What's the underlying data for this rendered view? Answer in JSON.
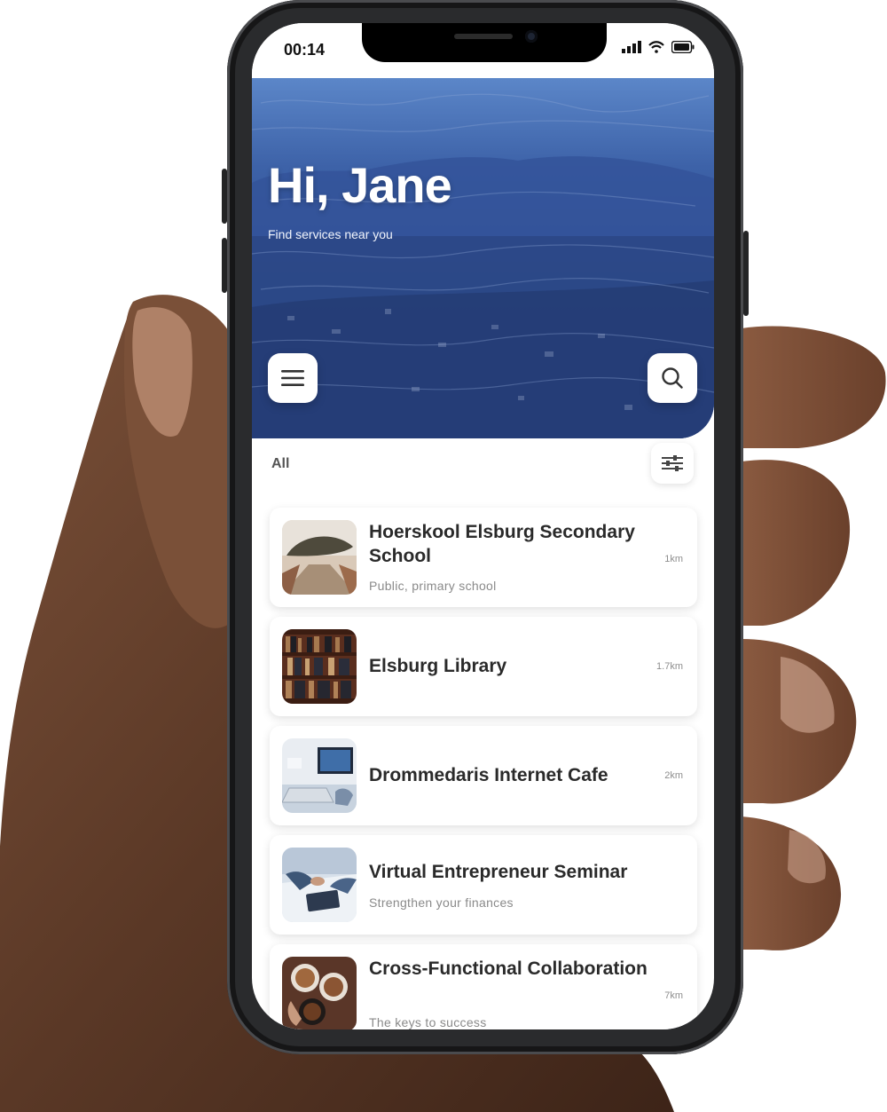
{
  "status_bar": {
    "time": "00:14"
  },
  "header": {
    "greeting": "Hi, Jane",
    "subtitle": "Find services near you"
  },
  "filter": {
    "label": "All"
  },
  "services": [
    {
      "title": "Hoerskool Elsburg Secondary School",
      "subtitle": "Public, primary school",
      "distance": "1km",
      "thumb_icon": "school-path-image"
    },
    {
      "title": "Elsburg Library",
      "subtitle": "",
      "distance": "1.7km",
      "thumb_icon": "bookshelf-image"
    },
    {
      "title": "Drommedaris Internet Cafe",
      "subtitle": "",
      "distance": "2km",
      "thumb_icon": "laptop-desk-image"
    },
    {
      "title": "Virtual Entrepreneur Seminar",
      "subtitle": "Strengthen your finances",
      "distance": "",
      "thumb_icon": "meeting-image"
    },
    {
      "title": "Cross-Functional Collaboration",
      "subtitle": "The keys to success",
      "distance": "7km",
      "thumb_icon": "coffee-cups-image"
    }
  ],
  "colors": {
    "header_blue": "#2d4b8d",
    "text_dark": "#2a2a2a",
    "text_muted": "#8a8a8a",
    "phone_frame": "#2a2b2d",
    "skin": "#5a3a27"
  }
}
